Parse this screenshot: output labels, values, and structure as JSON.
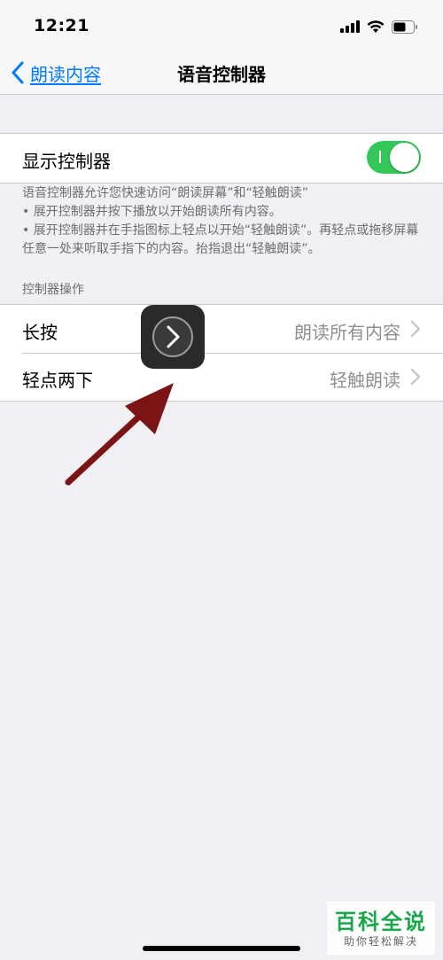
{
  "status_bar": {
    "time": "12:21",
    "icons": [
      "cellular-signal-icon",
      "wifi-icon",
      "battery-icon"
    ]
  },
  "nav": {
    "back_label": "朗读内容",
    "title": "语音控制器"
  },
  "show_controller": {
    "label": "显示控制器",
    "toggle_on": true,
    "footnote": "语音控制器允许您快速访问“朗读屏幕”和“轻触朗读”\n• 展开控制器并按下播放以开始朗读所有内容。\n• 展开控制器并在手指图标上轻点以开始“轻触朗读”。再轻点或拖移屏幕任意一处来听取手指下的内容。抬指退出“轻触朗读”。"
  },
  "controller_actions": {
    "header": "控制器操作",
    "rows": [
      {
        "label": "长按",
        "value": "朗读所有内容"
      },
      {
        "label": "轻点两下",
        "value": "轻触朗读"
      }
    ]
  },
  "watermark": {
    "title": "百科全说",
    "subtitle": "助你轻松解决"
  },
  "colors": {
    "accent": "#007aff",
    "toggle_on": "#34c759",
    "arrow": "#7b1414",
    "background": "#efeff4"
  }
}
